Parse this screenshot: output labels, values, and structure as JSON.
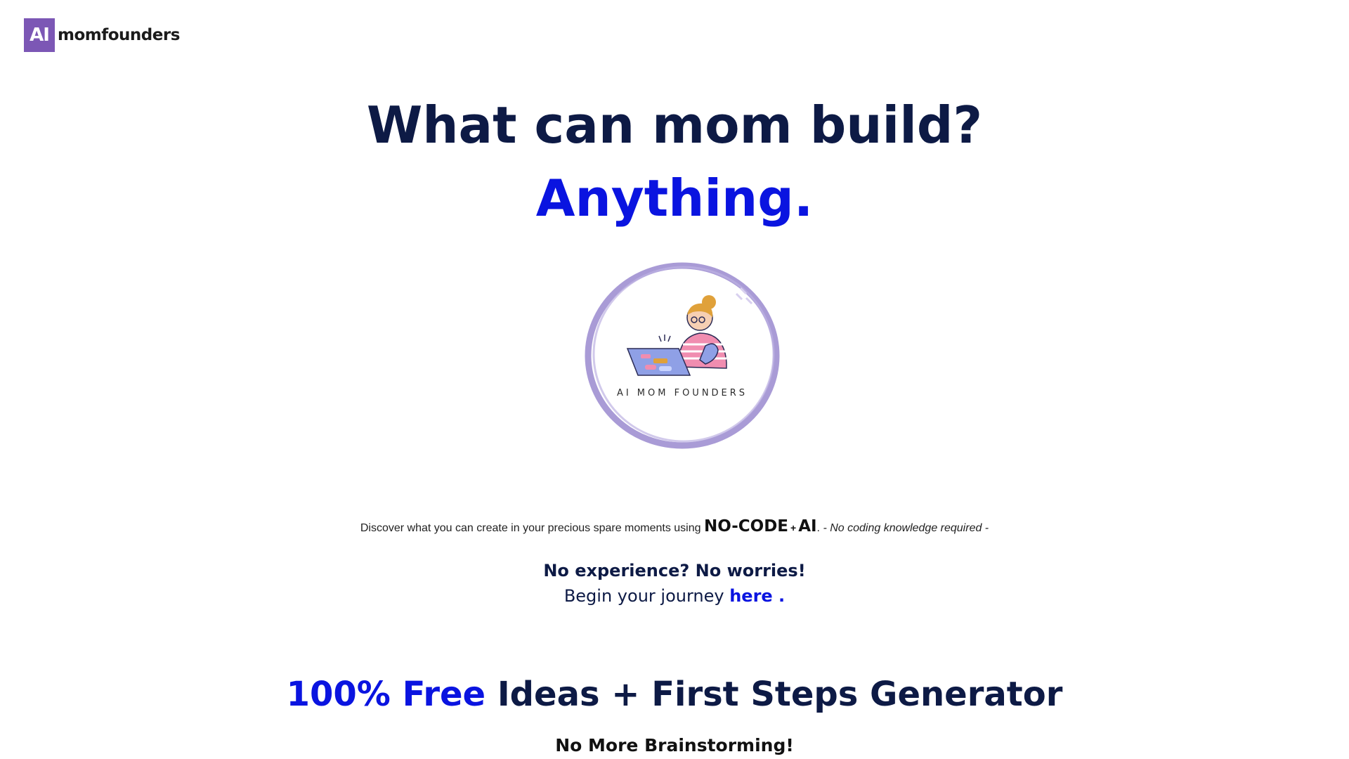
{
  "header": {
    "logo_mark": "AI",
    "logo_text": "momfounders"
  },
  "hero": {
    "line1": "What can mom build?",
    "line2": "Anything."
  },
  "badge": {
    "text": "AI MOM FOUNDERS",
    "ring_color": "#a99bd6"
  },
  "discover": {
    "lead": "Discover what you can create in your precious spare moments using ",
    "nocode": "NO-CODE",
    "plus": "+",
    "ai": "AI",
    "period": ".",
    "note": " - No coding knowledge required -"
  },
  "experience": {
    "heading": "No experience? No worries!",
    "begin_text": "Begin your journey ",
    "link": "here ."
  },
  "generator": {
    "highlight": "100% Free",
    "rest": " Ideas + First Steps Generator",
    "subheading": "No More Brainstorming!"
  },
  "colors": {
    "navy": "#0d1a45",
    "blue": "#0a14e0",
    "purple": "#7c57b5"
  }
}
